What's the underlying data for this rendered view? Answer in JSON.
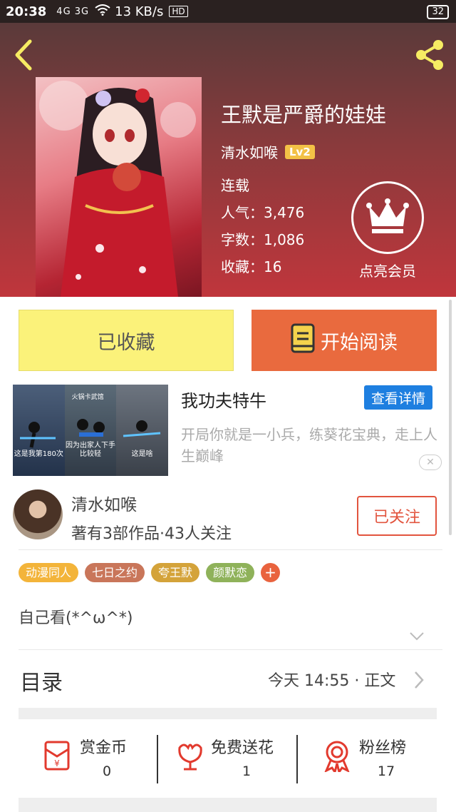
{
  "status_bar": {
    "time": "20:38",
    "signal_text": "4G 3G",
    "speed": "13 KB/s",
    "hd": "HD",
    "battery": "32"
  },
  "header": {
    "back_icon": "chevron-left-icon",
    "share_icon": "share-icon"
  },
  "book": {
    "title": "王默是严爵的娃娃",
    "author": "清水如喉",
    "level": "Lv2",
    "status": "连载",
    "popularity": "人气：3,476",
    "word_count": "字数：1,086",
    "favorites": "收藏：16"
  },
  "vip": {
    "icon": "crown-icon",
    "label": "点亮会员"
  },
  "actions": {
    "collected_label": "已收藏",
    "read_label": "开始阅读",
    "read_icon": "book-icon"
  },
  "ad": {
    "title": "我功夫特牛",
    "details_label": "查看详情",
    "description": "开局你就是一小兵，练葵花宝典，走上人生巅峰",
    "panels": [
      "这是我第180次",
      "因为出家人下手比较轻",
      "这是啥"
    ],
    "panel_header": "火锅卡武馆",
    "close_icon": "close-icon"
  },
  "author_block": {
    "name": "清水如喉",
    "works": "著有3部作品·43人关注",
    "follow_label": "已关注"
  },
  "tags": [
    {
      "label": "动漫同人",
      "color": "#f3b43a"
    },
    {
      "label": "七日之约",
      "color": "#c9765a"
    },
    {
      "label": "夸王默",
      "color": "#d4a33a"
    },
    {
      "label": "颜默恋",
      "color": "#8fb25a"
    }
  ],
  "tag_add": "+",
  "intro": "自己看(*^ω^*)",
  "catalog": {
    "title": "目录",
    "update": "今天 14:55 · 正文"
  },
  "bottom": {
    "reward": {
      "label": "赏金币",
      "value": "0",
      "icon": "red-envelope-icon"
    },
    "flower": {
      "label": "免费送花",
      "value": "1",
      "icon": "flower-icon"
    },
    "fans": {
      "label": "粉丝榜",
      "value": "17",
      "icon": "medal-icon"
    }
  },
  "colors": {
    "accent_orange": "#e96a3e",
    "collected_yellow": "#fbf27a",
    "follow_red": "#e2543e",
    "details_blue": "#1e7fe0"
  }
}
